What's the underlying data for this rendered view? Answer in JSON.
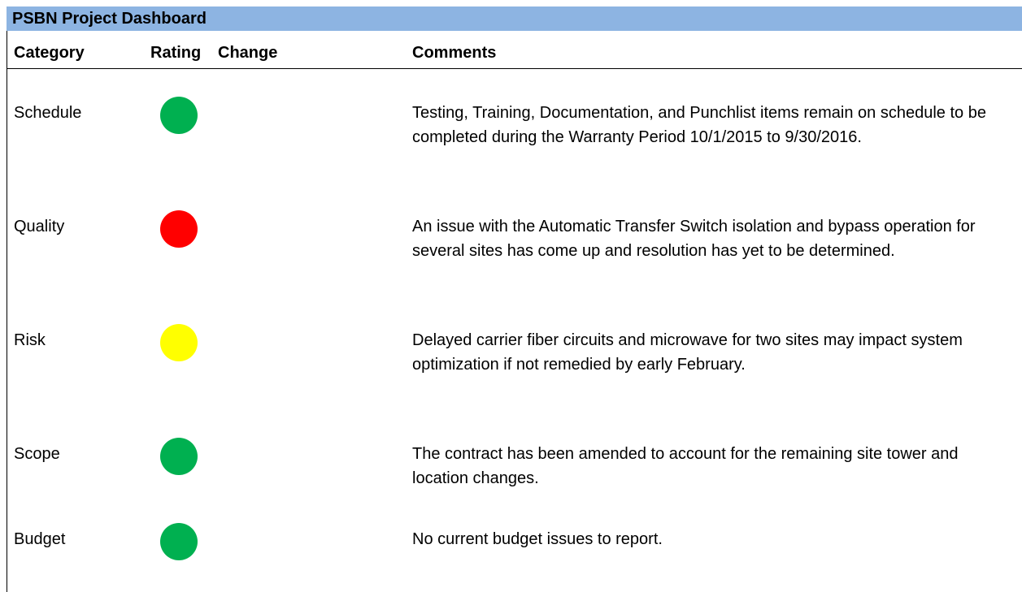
{
  "title": "PSBN Project Dashboard",
  "headers": {
    "category": "Category",
    "rating": "Rating",
    "change": "Change",
    "comments": "Comments"
  },
  "rows": [
    {
      "category": "Schedule",
      "rating": "green",
      "rating_color": "#00b050",
      "change": "",
      "comment": "Testing, Training, Documentation, and Punchlist items remain on schedule to be completed during the Warranty Period 10/1/2015 to 9/30/2016."
    },
    {
      "category": "Quality",
      "rating": "red",
      "rating_color": "#ff0000",
      "change": "",
      "comment": "An issue with the Automatic Transfer Switch isolation and bypass operation for several sites has come up and resolution has yet to be determined."
    },
    {
      "category": "Risk",
      "rating": "yellow",
      "rating_color": "#ffff00",
      "change": "",
      "comment": "Delayed carrier fiber circuits and microwave for two sites may impact system optimization if not remedied by early February."
    },
    {
      "category": "Scope",
      "rating": "green",
      "rating_color": "#00b050",
      "change": "",
      "comment": "The contract has been amended to account for the remaining site tower and location changes."
    },
    {
      "category": "Budget",
      "rating": "green",
      "rating_color": "#00b050",
      "change": "",
      "comment": "No current budget issues to report."
    }
  ],
  "colors": {
    "title_bar": "#8db4e2"
  }
}
